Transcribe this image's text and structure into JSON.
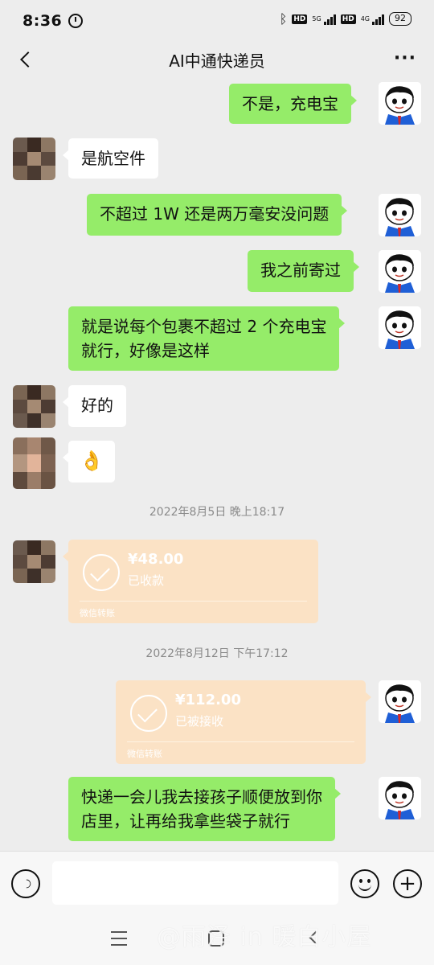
{
  "status_bar": {
    "time": "8:36",
    "hd1": "HD",
    "net1": "5G",
    "hd2": "HD",
    "net2": "4G",
    "battery": "92"
  },
  "header": {
    "title": "AI中通快递员",
    "more": "···"
  },
  "messages": [
    {
      "side": "right",
      "text": "不是，充电宝"
    },
    {
      "side": "left",
      "text": "是航空件"
    },
    {
      "side": "right",
      "text": "不超过 1W 还是两万毫安没问题"
    },
    {
      "side": "right",
      "text": "我之前寄过"
    },
    {
      "side": "right",
      "text_line1": "就是说每个包裹不超过 2 个充电宝",
      "text_line2": "就行，好像是这样"
    },
    {
      "side": "left",
      "text": "好的"
    },
    {
      "side": "left",
      "emoji": "👌"
    }
  ],
  "timestamps": [
    "2022年8月5日  晚上18:17",
    "2022年8月12日  下午17:12"
  ],
  "transfers": [
    {
      "side": "left",
      "amount": "¥48.00",
      "status": "已收款",
      "footer": "微信转账"
    },
    {
      "side": "right",
      "amount": "¥112.00",
      "status": "已被接收",
      "footer": "微信转账"
    }
  ],
  "last_message": {
    "side": "right",
    "text_line1": "快递一会儿我去接孩子顺便放到你",
    "text_line2": "店里，让再给我拿些袋子就行"
  },
  "input_bar": {
    "placeholder": ""
  },
  "watermark": "@雨泽 in 暖白小屋",
  "colors": {
    "background": "#ededed",
    "sent_bubble": "#95ec69",
    "received_bubble": "#ffffff",
    "transfer_card": "#fbe2c5"
  }
}
